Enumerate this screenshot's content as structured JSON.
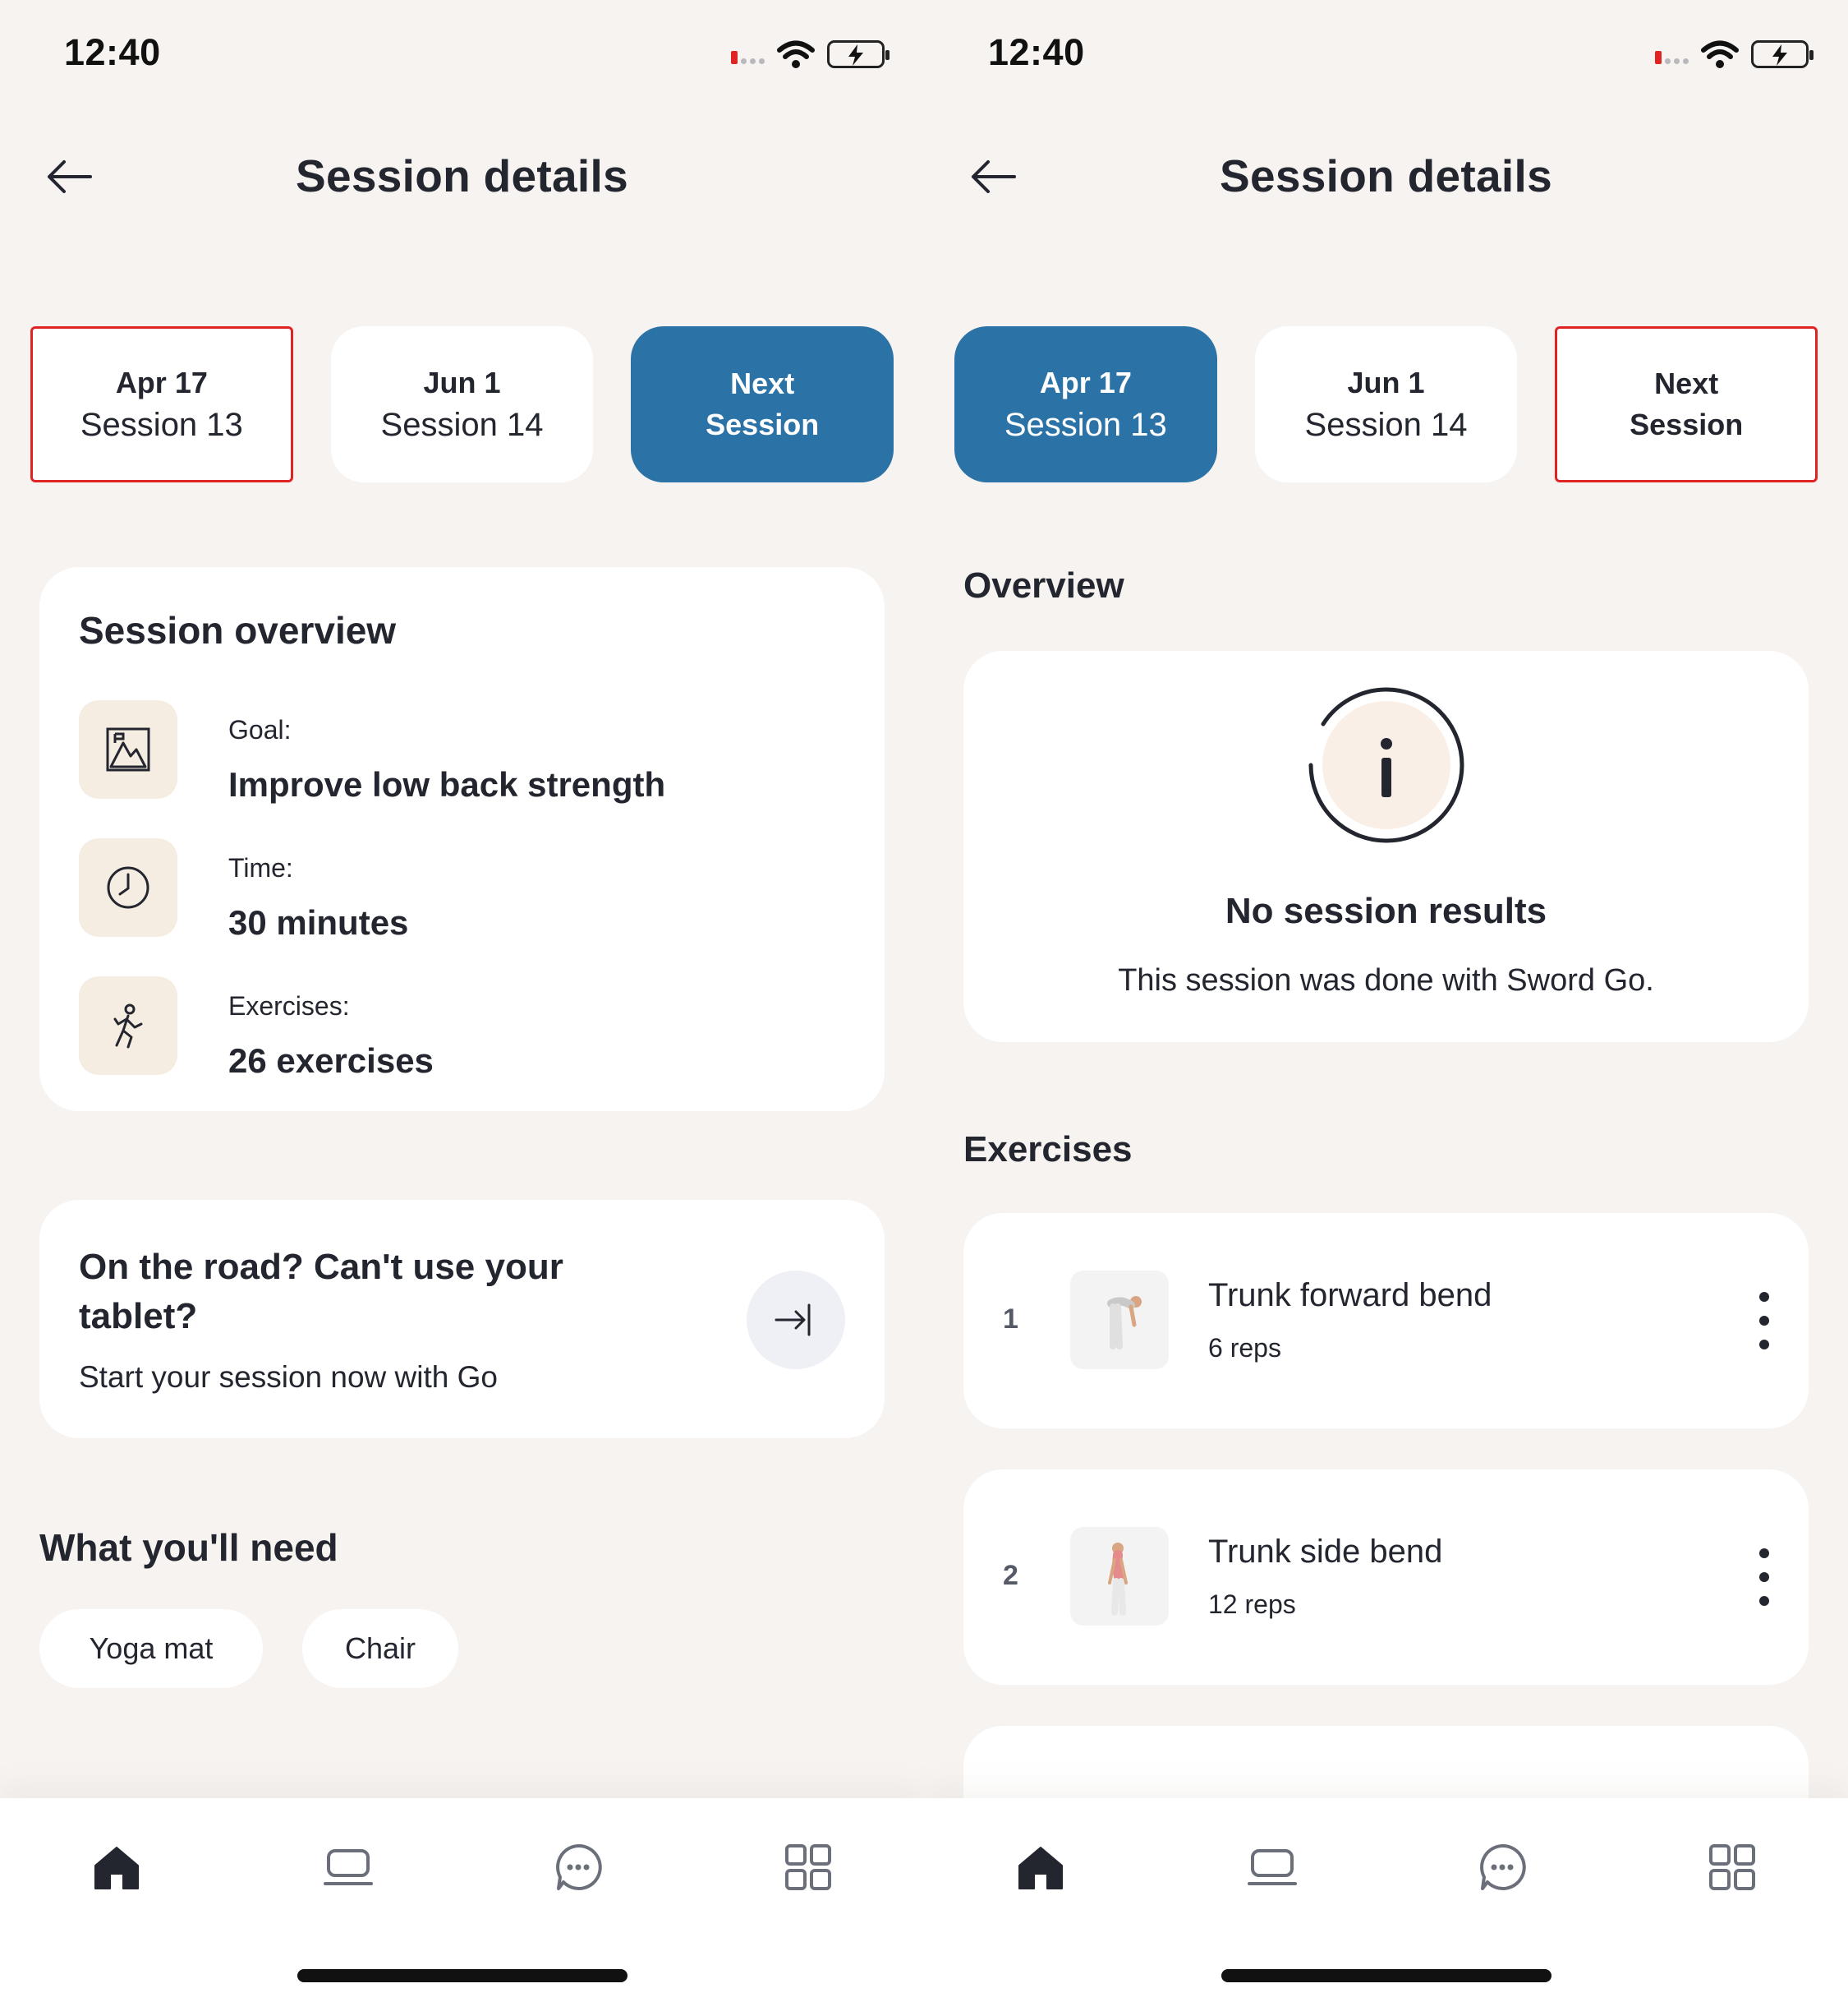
{
  "status_bar": {
    "time": "12:40"
  },
  "header": {
    "title": "Session details"
  },
  "tabs": [
    {
      "line1": "Apr 17",
      "line2": "Session 13"
    },
    {
      "line1": "Jun 1",
      "line2": "Session 14"
    },
    {
      "line1": "Next",
      "line2": "Session"
    }
  ],
  "overview": {
    "card_title": "Session overview",
    "goal_label": "Goal:",
    "goal_value": "Improve low back strength",
    "time_label": "Time:",
    "time_value": "30 minutes",
    "exercises_label": "Exercises:",
    "exercises_value": "26 exercises"
  },
  "road": {
    "title": "On the road? Can't use your tablet?",
    "subtitle": "Start your session now with Go"
  },
  "need": {
    "title": "What you'll need",
    "items": [
      "Yoga mat",
      "Chair"
    ]
  },
  "results": {
    "overview_heading": "Overview",
    "empty_title": "No session results",
    "empty_subtitle": "This session was done with Sword Go.",
    "exercises_heading": "Exercises",
    "exercises": [
      {
        "number": "1",
        "name": "Trunk forward bend",
        "reps": "6 reps"
      },
      {
        "number": "2",
        "name": "Trunk side bend",
        "reps": "12 reps"
      }
    ]
  },
  "colors": {
    "accent": "#2b72a6",
    "background": "#f6f3f1",
    "card": "#ffffff",
    "icon_bg": "#f6ede2",
    "text": "#23262f"
  },
  "icons": {
    "back": "arrow-left-icon",
    "goal": "mountain-icon",
    "time": "clock-icon",
    "exercises": "running-person-icon",
    "road": "arrow-right-exit-icon",
    "more": "more-vertical-icon",
    "nav": [
      "home-icon",
      "laptop-icon",
      "chat-icon",
      "apps-grid-icon"
    ]
  }
}
